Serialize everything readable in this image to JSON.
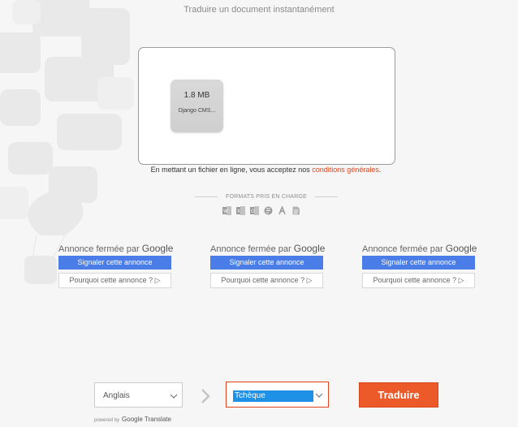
{
  "header": {
    "headline": "Traduire un document instantanément"
  },
  "upload": {
    "file": {
      "size": "1.8 MB",
      "name": "Django CMS..."
    },
    "terms_prefix": "En mettant un fichier en ligne, vous acceptez nos",
    "terms_link": "conditions générales",
    "terms_suffix": "."
  },
  "formats": {
    "title": "FORMATS PRIS EN CHARGE",
    "icons": [
      "word-icon",
      "excel-icon",
      "outlook-icon",
      "powerpoint-icon",
      "pdf-icon",
      "text-file-icon"
    ]
  },
  "ads": [
    {
      "closed_prefix": "Annonce fermée par",
      "closed_brand": "Google",
      "report_label": "Signaler cette annonce",
      "why_label": "Pourquoi cette annonce ? ▷"
    },
    {
      "closed_prefix": "Annonce fermée par",
      "closed_brand": "Google",
      "report_label": "Signaler cette annonce",
      "why_label": "Pourquoi cette annonce ? ▷"
    },
    {
      "closed_prefix": "Annonce fermée par",
      "closed_brand": "Google",
      "report_label": "Signaler cette annonce",
      "why_label": "Pourquoi cette annonce ? ▷"
    }
  ],
  "translate": {
    "source_lang": "Anglais",
    "target_lang": "Tchèque",
    "button_label": "Traduire",
    "powered_by": "powered by",
    "powered_brand": "Google Translate"
  },
  "colors": {
    "accent": "#e0441a",
    "button": "#ec5a2a",
    "ad_blue": "#4a7de8",
    "select_highlight": "#1e90e6"
  }
}
